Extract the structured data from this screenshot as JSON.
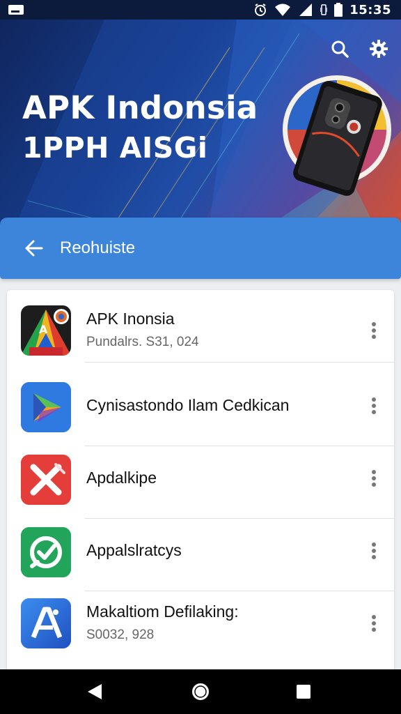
{
  "status_bar": {
    "time": "15:35",
    "icons": [
      "notification-icon",
      "alarm-icon",
      "wifi-icon",
      "signal-icon",
      "vibrate-icon",
      "battery-icon"
    ]
  },
  "hero": {
    "title": "APK Indonsia",
    "subtitle": "1PPH AISGi",
    "actions": [
      "search-icon",
      "settings-gear-icon"
    ]
  },
  "nav_bar": {
    "back_icon": "arrow-left-icon",
    "title": "Reohuiste"
  },
  "apps": [
    {
      "name": "APK Inonsia",
      "subtitle": "Pundalrs. S31, 024",
      "icon": "apk-indonesia-logo",
      "menu_icon": "more-vert-icon"
    },
    {
      "name": "Cynisastondo Ilam Cedkican",
      "subtitle": "",
      "icon": "play-triangle-logo",
      "menu_icon": "more-vert-icon"
    },
    {
      "name": "Apdalkipe",
      "subtitle": "",
      "icon": "red-x-logo",
      "menu_icon": "more-vert-icon"
    },
    {
      "name": "Appalslratcys",
      "subtitle": "",
      "icon": "green-check-logo",
      "menu_icon": "more-vert-icon"
    },
    {
      "name": "Makaltiom Defilaking:",
      "subtitle": "S0032, 928",
      "icon": "blue-a-logo",
      "menu_icon": "more-vert-icon"
    }
  ],
  "system_nav": [
    "back-triangle-icon",
    "home-circle-icon",
    "recents-square-icon"
  ],
  "colors": {
    "nav_bar": "#3d84db",
    "hero_dark": "#10265e",
    "list_bg": "#ffffff",
    "page_bg": "#eceef2"
  }
}
